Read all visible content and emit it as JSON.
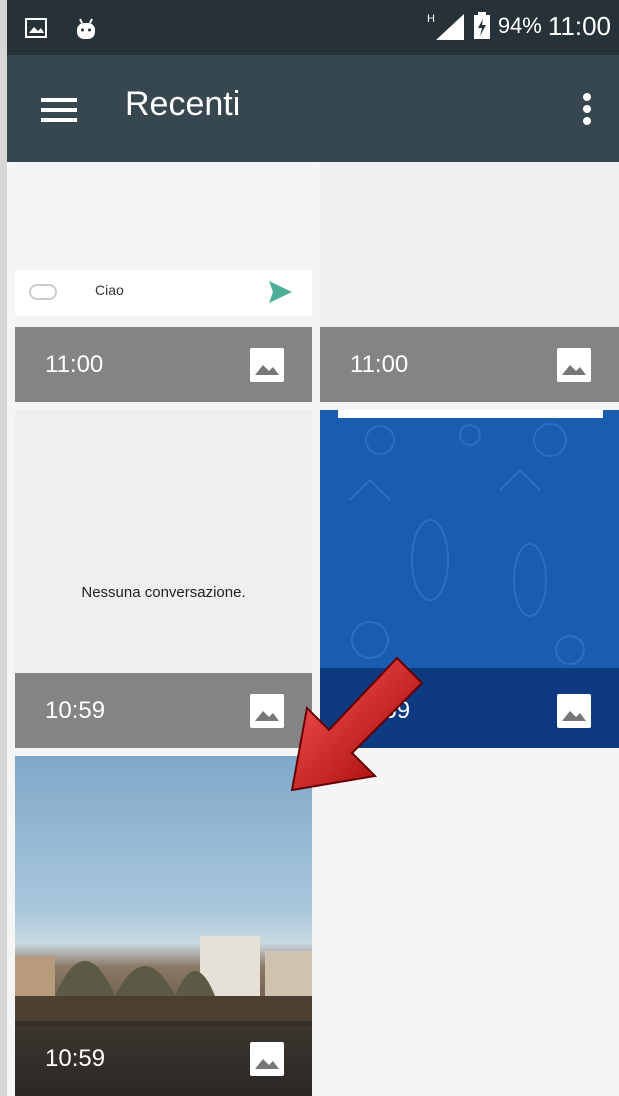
{
  "status_bar": {
    "battery_percent": "94%",
    "time": "11:00",
    "network": "H"
  },
  "app_bar": {
    "title": "Recenti"
  },
  "tiles": [
    {
      "time": "11:00",
      "chat_text": "Ciao"
    },
    {
      "time": "11:00"
    },
    {
      "time": "10:59",
      "message": "Nessuna conversazione."
    },
    {
      "time": "10:59"
    },
    {
      "time": "10:59"
    }
  ],
  "colors": {
    "status_bar_bg": "#263238",
    "app_bar_bg": "#37474f",
    "label_bg": "#787878",
    "annotation_arrow": "#c00000"
  }
}
